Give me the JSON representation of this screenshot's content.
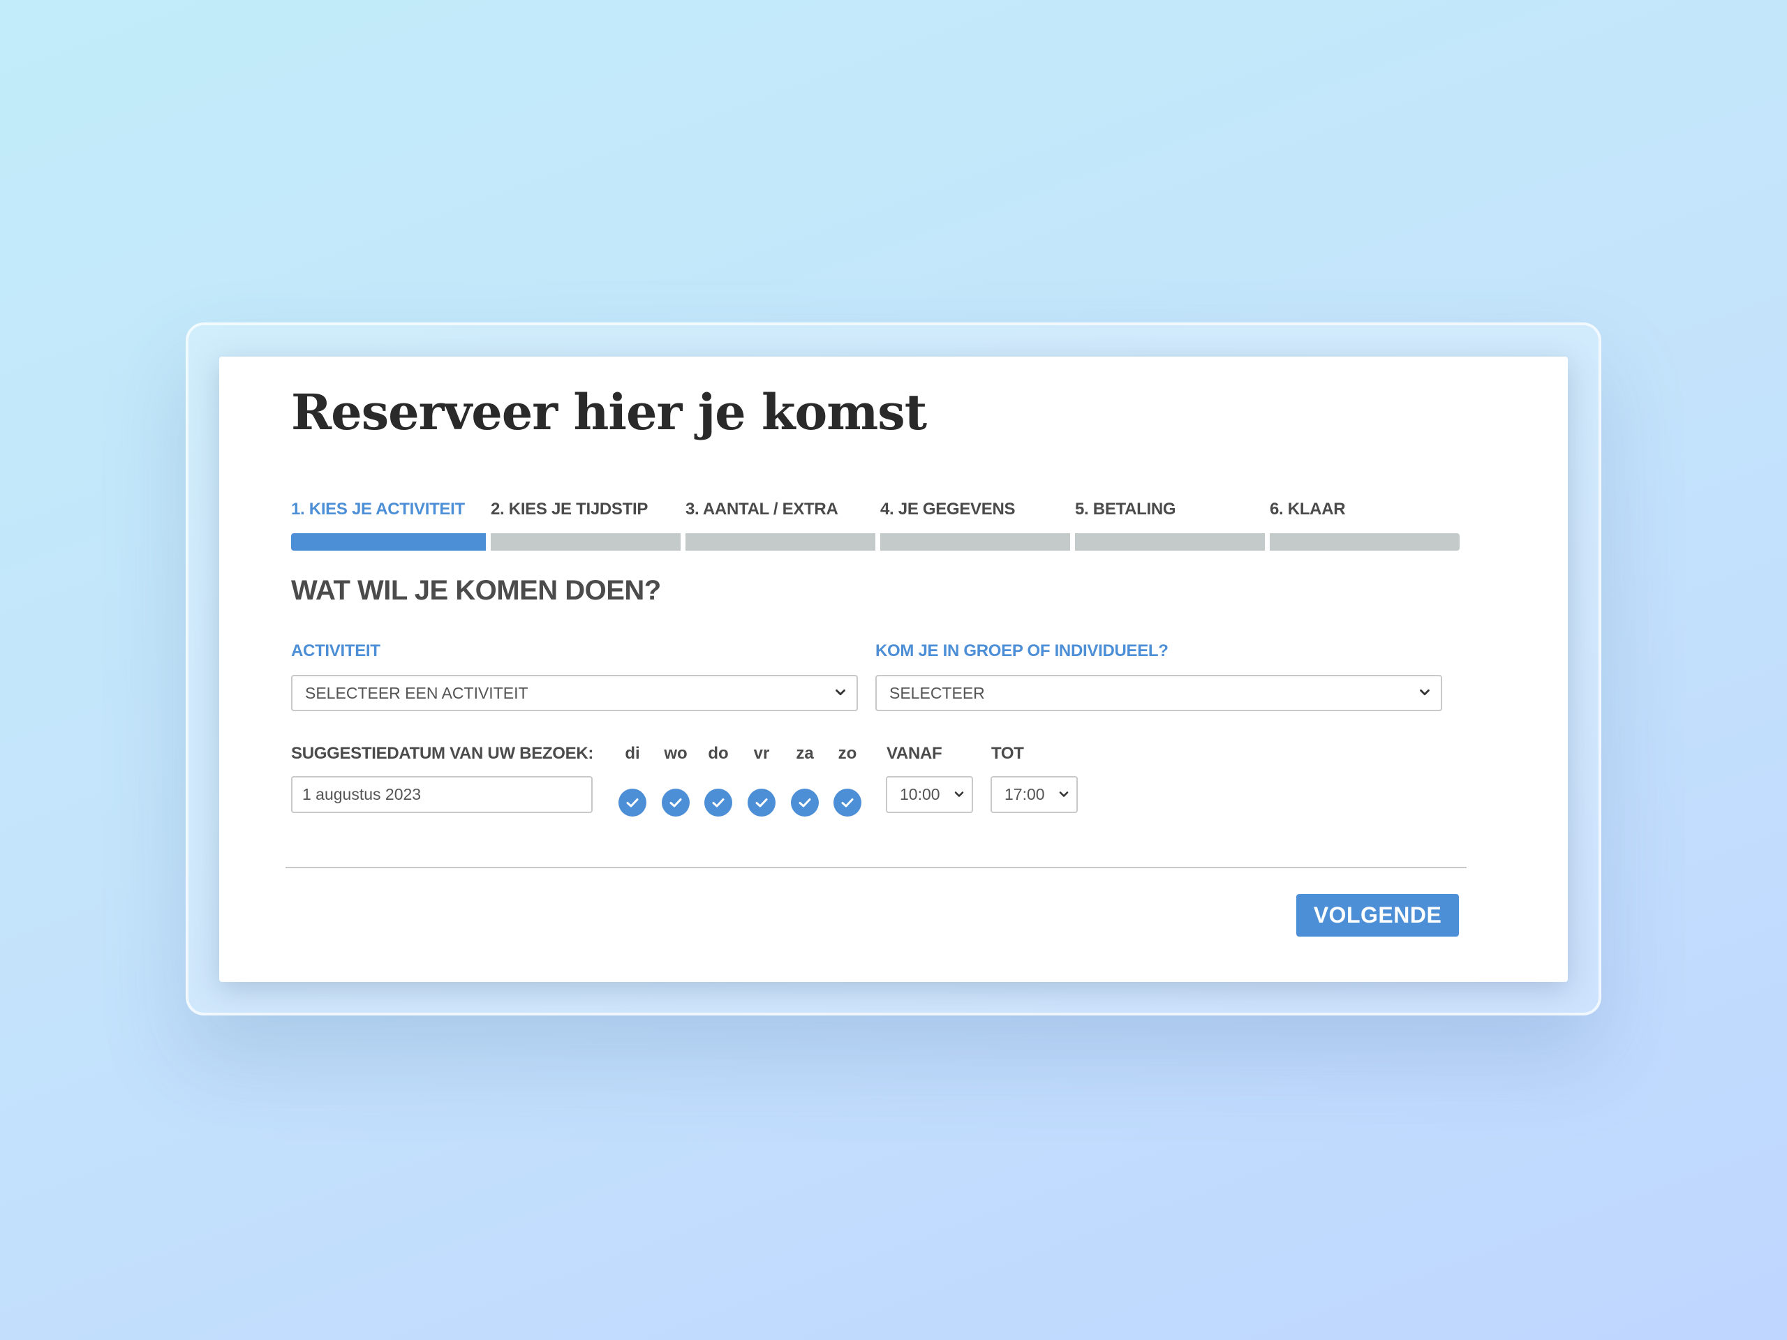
{
  "form": {
    "title": "Reserveer hier je komst",
    "steps": [
      {
        "label": "1. KIES JE ACTIVITEIT"
      },
      {
        "label": "2. KIES JE TIJDSTIP"
      },
      {
        "label": "3. AANTAL / EXTRA"
      },
      {
        "label": "4. JE GEGEVENS"
      },
      {
        "label": "5. BETALING"
      },
      {
        "label": "6. KLAAR"
      }
    ],
    "current_step": 1,
    "section_title": "WAT WIL JE KOMEN DOEN?",
    "activity": {
      "label": "ACTIVITEIT",
      "selected": "SELECTEER EEN ACTIVITEIT"
    },
    "group": {
      "label": "KOM JE IN GROEP OF INDIVIDUEEL?",
      "selected": "SELECTEER"
    },
    "visit_date": {
      "label": "SUGGESTIEDATUM VAN UW BEZOEK:",
      "value": "1 augustus 2023"
    },
    "days": [
      {
        "label": "di",
        "checked": true
      },
      {
        "label": "wo",
        "checked": true
      },
      {
        "label": "do",
        "checked": true
      },
      {
        "label": "vr",
        "checked": true
      },
      {
        "label": "za",
        "checked": true
      },
      {
        "label": "zo",
        "checked": true
      }
    ],
    "from_time": {
      "label": "VANAF",
      "selected": "10:00"
    },
    "to_time": {
      "label": "TOT",
      "selected": "17:00"
    },
    "next_label": "VOLGENDE"
  },
  "icons": {
    "chevron": "chevron-down-icon",
    "check": "check-icon"
  },
  "colors": {
    "accent": "#4d8fd6",
    "inactive_bar": "#c4c9c9",
    "text_dark": "#2a2a2a"
  }
}
